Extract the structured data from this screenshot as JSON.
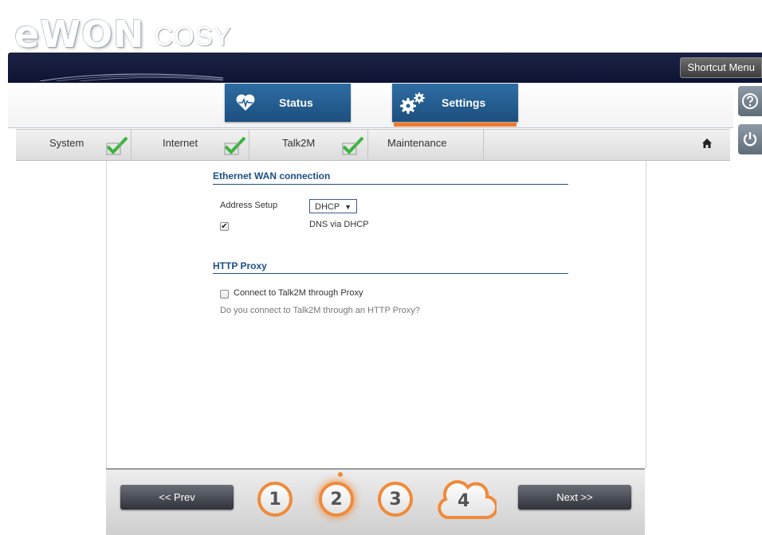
{
  "header": {
    "brand": "eWON",
    "model": "COSY",
    "shortcut_menu": "Shortcut Menu"
  },
  "main_tabs": [
    {
      "label": "Status",
      "icon": "heartbeat-icon",
      "active": false
    },
    {
      "label": "Settings",
      "icon": "gears-icon",
      "active": true
    }
  ],
  "side_icons": [
    "help-icon",
    "power-icon"
  ],
  "steps": [
    {
      "label": "System",
      "done": true
    },
    {
      "label": "Internet",
      "done": true
    },
    {
      "label": "Talk2M",
      "done": true
    },
    {
      "label": "Maintenance",
      "done": false
    }
  ],
  "content": {
    "ethernet": {
      "title": "Ethernet WAN connection",
      "address_setup_label": "Address Setup",
      "address_setup_value": "DHCP",
      "dns_label": "DNS via DHCP",
      "dns_checked": true
    },
    "proxy": {
      "title": "HTTP Proxy",
      "connect_label": "Connect to Talk2M through Proxy",
      "connect_checked": false,
      "hint": "Do you connect to Talk2M through an HTTP Proxy?"
    }
  },
  "wizard": {
    "prev_label": "<< Prev",
    "next_label": "Next >>",
    "steps": [
      "1",
      "2",
      "3",
      "4"
    ],
    "current_step": 2
  },
  "colors": {
    "accent_orange": "#f07a2a",
    "tab_blue": "#2362a0",
    "title_blue": "#1c4f86",
    "check_green": "#3cb43c"
  }
}
